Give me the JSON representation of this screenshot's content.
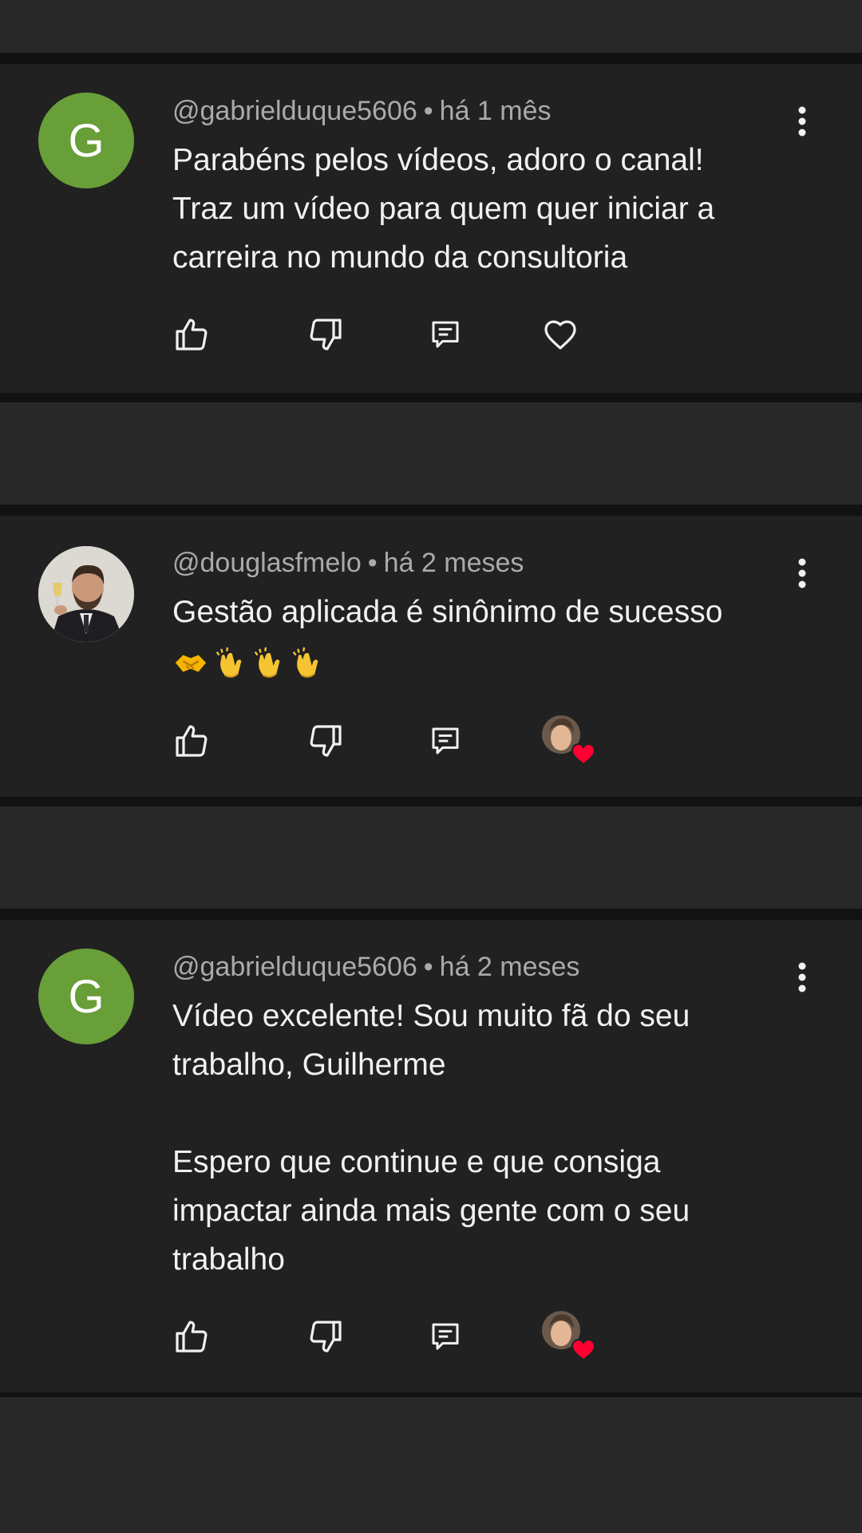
{
  "comments": [
    {
      "avatar_letter": "G",
      "avatar_color": "#689f38",
      "author": "@gabrielduque5606",
      "separator": "•",
      "time": "há 1 mês",
      "lines": [
        "Parabéns pelos vídeos, adoro o canal!",
        "Traz um vídeo para quem quer iniciar a",
        "carreira no mundo da consultoria"
      ],
      "hearted": false
    },
    {
      "avatar_type": "photo",
      "author": "@douglasfmelo",
      "separator": "•",
      "time": "há 2 meses",
      "lines": [
        "Gestão aplicada é sinônimo de sucesso"
      ],
      "emoji_line": [
        "handshake",
        "clapping-hands",
        "clapping-hands",
        "clapping-hands"
      ],
      "hearted": true
    },
    {
      "avatar_letter": "G",
      "avatar_color": "#689f38",
      "author": "@gabrielduque5606",
      "separator": "•",
      "time": "há 2 meses",
      "lines": [
        "Vídeo excelente! Sou muito fã do seu",
        "trabalho, Guilherme",
        "",
        "Espero que continue e que consiga",
        "impactar ainda mais gente com o seu",
        "trabalho"
      ],
      "hearted": true
    }
  ],
  "icons": {
    "like": "thumbs-up-icon",
    "dislike": "thumbs-down-icon",
    "reply": "reply-icon",
    "heart": "heart-icon",
    "more": "more-vert-icon"
  },
  "colors": {
    "card_bg": "#212121",
    "page_bg": "#282828",
    "separator": "#121212",
    "heart_red": "#ff0033",
    "meta_text": "#aaaaaa",
    "body_text": "#f1f1f1"
  }
}
